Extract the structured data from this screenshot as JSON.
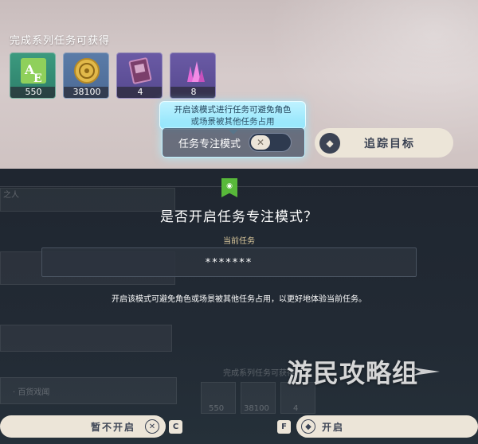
{
  "rewards": {
    "title": "完成系列任务可获得",
    "items": [
      {
        "icon": "guide-book-icon",
        "count": "550"
      },
      {
        "icon": "mora-coin-icon",
        "count": "38100"
      },
      {
        "icon": "hero-wit-book-icon",
        "count": "4"
      },
      {
        "icon": "crystal-ore-icon",
        "count": "8"
      }
    ]
  },
  "focus_mode": {
    "tooltip_line1": "开启该模式进行任务可避免角色",
    "tooltip_line2": "或场景被其他任务占用",
    "label": "任务专注模式",
    "toggle_state": "off",
    "toggle_glyph": "✕"
  },
  "track_button": {
    "label": "追踪目标",
    "icon": "diamond-icon"
  },
  "dialog": {
    "title": "是否开启任务专注模式？",
    "current_label": "当前任务",
    "quest_name": "*******",
    "description": "开启该模式可避免角色或场景被其他任务占用，以更好地体验当前任务。",
    "bg_fragment_1": "之人",
    "bg_fragment_2": "· 百货戏闻",
    "bg_fragment_3": "完成系列任务可获得",
    "bg_count_1": "550",
    "bg_count_2": "38100",
    "bg_count_3": "4"
  },
  "watermark": "游民攻略组",
  "buttons": {
    "cancel_label": "暂不开启",
    "cancel_glyph": "✕",
    "cancel_key": "C",
    "open_label": "开启",
    "open_key": "F"
  },
  "colors": {
    "accent_green": "#58b83a",
    "button_bg": "#ece5d8",
    "tooltip_cyan": "#8ee4fb"
  }
}
